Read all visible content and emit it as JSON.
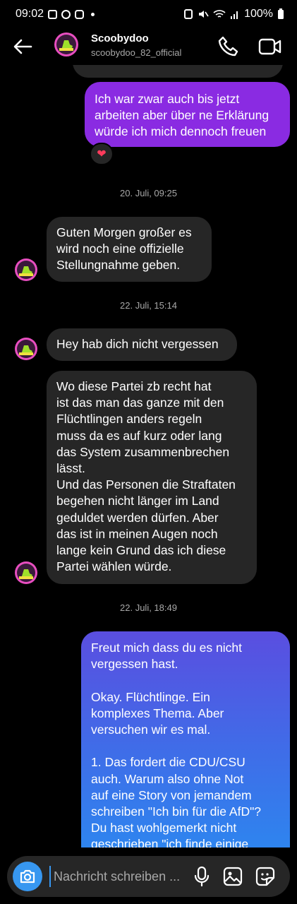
{
  "status_bar": {
    "time": "09:02",
    "battery": "100%"
  },
  "header": {
    "contact_name": "Scoobydoo",
    "contact_handle": "scoobydoo_82_official"
  },
  "messages": [
    {
      "kind": "out",
      "text": "Ich war zwar auch bis jetzt\narbeiten aber über ne Erklärung\nwürde ich mich dennoch freuen",
      "reaction": "❤"
    },
    {
      "kind": "date",
      "text": "20. Juli, 09:25"
    },
    {
      "kind": "in",
      "text": "Guten Morgen großer es\nwird noch eine offizielle\nStellungnahme geben."
    },
    {
      "kind": "date",
      "text": "22. Juli, 15:14"
    },
    {
      "kind": "in",
      "text": "Hey hab dich nicht vergessen"
    },
    {
      "kind": "in",
      "text": "Wo diese Partei zb recht hat\nist das man das ganze mit den\nFlüchtlingen anders regeln\nmuss da es auf kurz oder lang\ndas System zusammenbrechen\nlässt.\nUnd das Personen die Straftaten\nbegehen nicht länger im Land\ngeduldet werden dürfen. Aber\ndas ist in meinen Augen noch\nlange kein Grund das ich diese\nPartei wählen würde."
    },
    {
      "kind": "date",
      "text": "22. Juli, 18:49"
    },
    {
      "kind": "out",
      "text": "Freut mich dass du es nicht\nvergessen hast.\n\nOkay. Flüchtlinge. Ein\nkomplexes Thema. Aber\nversuchen wir es mal.\n\n1. Das fordert die CDU/CSU\nauch. Warum also ohne Not\nauf eine Story von jemandem\nschreiben \"Ich bin für die AfD\"?\nDu hast wohlgemerkt nicht\ngeschrieben \"ich finde einige"
    }
  ],
  "composer": {
    "placeholder": "Nachricht schreiben ..."
  },
  "icons": {
    "back": "arrow-left-icon",
    "call": "phone-icon",
    "video": "video-camera-icon",
    "camera": "camera-icon",
    "mic": "microphone-icon",
    "gallery": "image-icon",
    "sticker": "sticker-icon"
  },
  "colors": {
    "outgoing_purple": "#8a2be2",
    "outgoing_gradient_top": "#5a4ee0",
    "outgoing_gradient_bottom": "#2a8af0",
    "incoming": "#262626",
    "accent_blue": "#3797f0"
  }
}
